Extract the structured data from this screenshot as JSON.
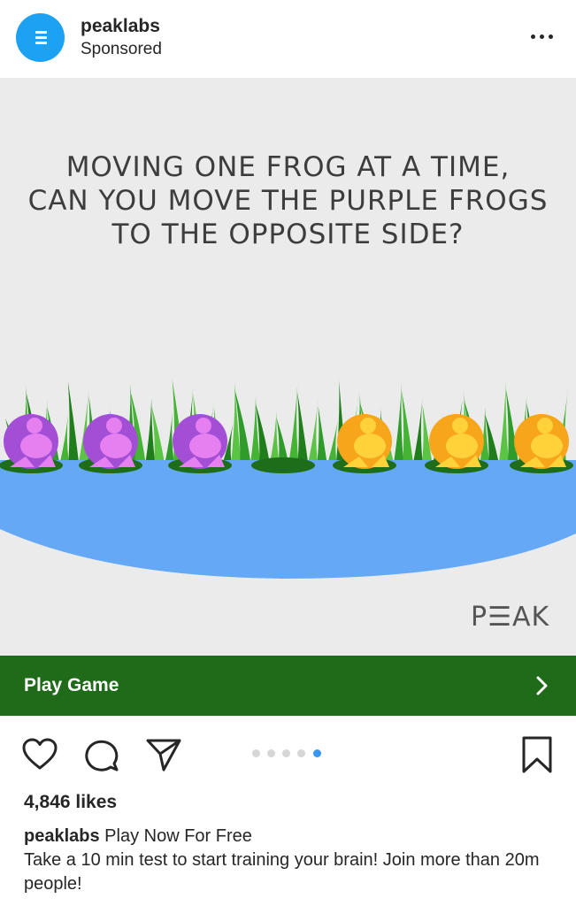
{
  "header": {
    "username": "peaklabs",
    "subtitle": "Sponsored",
    "avatar_icon": "menu-lines-icon",
    "more_icon": "more-options-icon",
    "avatar_color": "#1da1f2"
  },
  "media": {
    "headline_lines": [
      "MOVING ONE FROG AT A TIME,",
      "CAN YOU MOVE THE PURPLE FROGS",
      "TO THE OPPOSITE SIDE?"
    ],
    "logo": "P☰AK",
    "frogs": [
      "purple",
      "purple",
      "purple",
      "empty",
      "orange",
      "orange",
      "orange"
    ],
    "colors": {
      "background": "#ebebeb",
      "water": "#64a8f6",
      "grass": "#2e9b2a",
      "lilypad": "#1e6d1b",
      "purple_frog": "#a24fd6",
      "orange_frog": "#f7a51a"
    }
  },
  "cta": {
    "label": "Play Game",
    "icon": "chevron-right-icon",
    "color": "#1f6b1a"
  },
  "actions": {
    "like_icon": "heart-icon",
    "comment_icon": "comment-icon",
    "share_icon": "paper-plane-icon",
    "save_icon": "bookmark-icon",
    "carousel_count": 5,
    "carousel_active_index": 4
  },
  "likes": "4,846 likes",
  "caption": {
    "username": "peaklabs",
    "text_line1": "Play Now For Free",
    "text_line2": "Take a 10 min test to start training your brain! Join more than 20m people!"
  }
}
